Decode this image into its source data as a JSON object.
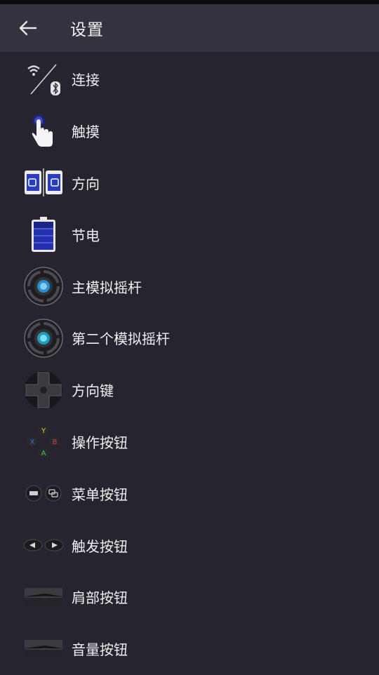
{
  "toolbar": {
    "title": "设置",
    "back_icon": "arrow-left-icon"
  },
  "colors": {
    "background": "#27242f",
    "toolbar": "#35313f",
    "text": "#f0f0f0"
  },
  "items": [
    {
      "label": "连接",
      "icon": "wifi-bluetooth-icon"
    },
    {
      "label": "触摸",
      "icon": "touch-icon"
    },
    {
      "label": "方向",
      "icon": "orientation-icon"
    },
    {
      "label": "节电",
      "icon": "battery-icon"
    },
    {
      "label": "主模拟摇杆",
      "icon": "analog-stick-icon"
    },
    {
      "label": "第二个模拟摇杆",
      "icon": "second-analog-stick-icon"
    },
    {
      "label": "方向键",
      "icon": "dpad-icon"
    },
    {
      "label": "操作按钮",
      "icon": "action-buttons-icon"
    },
    {
      "label": "菜单按钮",
      "icon": "menu-buttons-icon"
    },
    {
      "label": "触发按钮",
      "icon": "trigger-buttons-icon"
    },
    {
      "label": "肩部按钮",
      "icon": "shoulder-buttons-icon"
    },
    {
      "label": "音量按钮",
      "icon": "volume-buttons-icon"
    }
  ]
}
